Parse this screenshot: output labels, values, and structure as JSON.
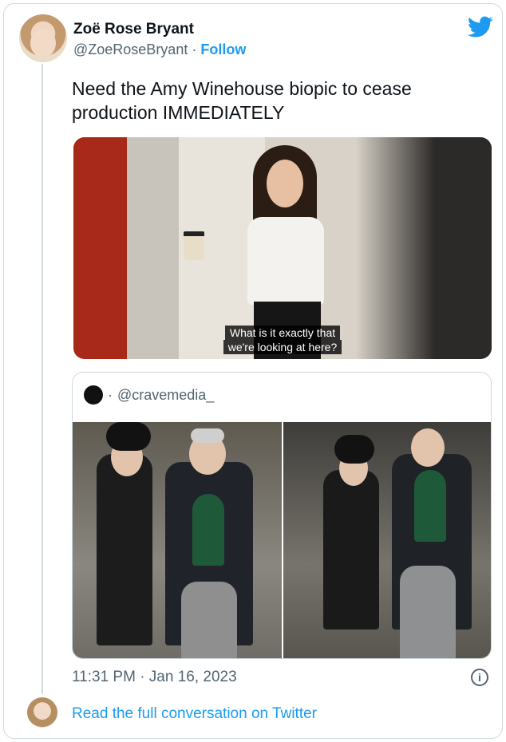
{
  "tweet": {
    "author_name": "Zoë Rose Bryant",
    "author_handle": "@ZoeRoseBryant",
    "separator": "·",
    "follow_label": "Follow",
    "text": "Need the Amy Winehouse biopic to cease production IMMEDIATELY",
    "media_subtitle_line1": "What is it exactly that",
    "media_subtitle_line2": "we're looking at here?",
    "timestamp": "11:31 PM · Jan 16, 2023",
    "read_conversation": "Read the full conversation on Twitter"
  },
  "quote": {
    "separator": "·",
    "handle": "@cravemedia_"
  },
  "icons": {
    "brand": "twitter-bird-icon",
    "info": "info-icon"
  },
  "colors": {
    "accent": "#1d9bf0",
    "secondary_text": "#536471",
    "border": "#cfd9de"
  }
}
